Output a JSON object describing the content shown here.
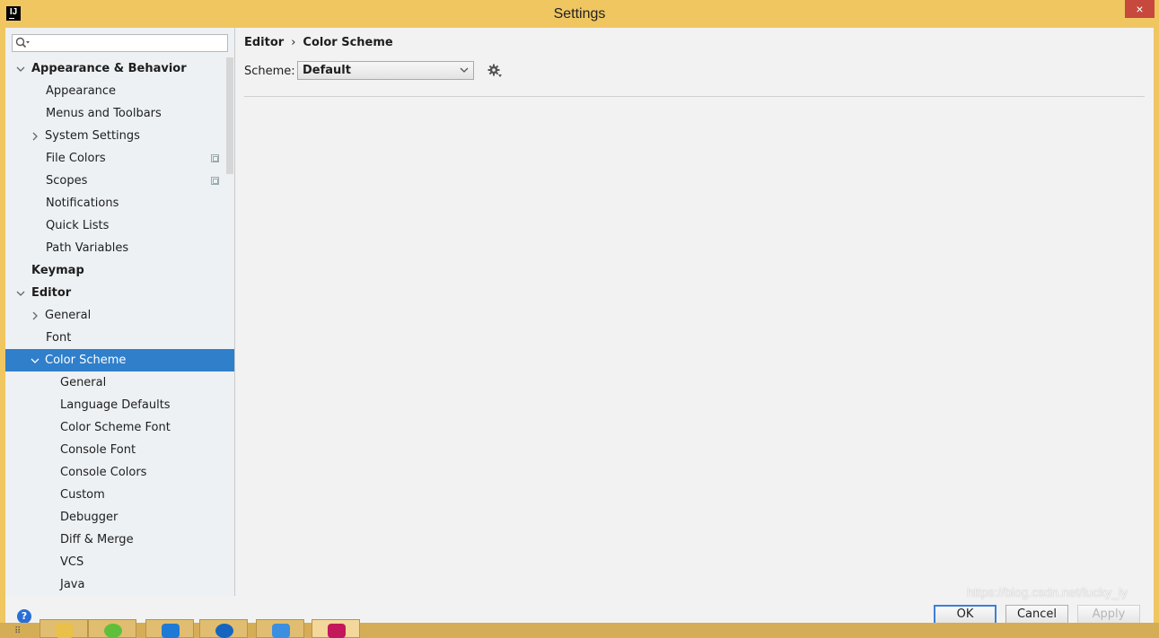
{
  "window": {
    "title": "Settings",
    "app_icon_text": "IJ",
    "close_glyph": "×"
  },
  "search": {
    "placeholder": "",
    "value": ""
  },
  "tree": [
    {
      "label": "Appearance & Behavior",
      "level": 0,
      "expander": "down",
      "bold": true
    },
    {
      "label": "Appearance",
      "level": 1
    },
    {
      "label": "Menus and Toolbars",
      "level": 1
    },
    {
      "label": "System Settings",
      "level": 1,
      "expander": "right"
    },
    {
      "label": "File Colors",
      "level": 1,
      "copy_icon": true
    },
    {
      "label": "Scopes",
      "level": 1,
      "copy_icon": true
    },
    {
      "label": "Notifications",
      "level": 1
    },
    {
      "label": "Quick Lists",
      "level": 1
    },
    {
      "label": "Path Variables",
      "level": 1
    },
    {
      "label": "Keymap",
      "level": 0,
      "bold": true
    },
    {
      "label": "Editor",
      "level": 0,
      "expander": "down",
      "bold": true
    },
    {
      "label": "General",
      "level": 1,
      "expander": "right"
    },
    {
      "label": "Font",
      "level": 1
    },
    {
      "label": "Color Scheme",
      "level": 1,
      "expander": "down",
      "selected": true
    },
    {
      "label": "General",
      "level": 2
    },
    {
      "label": "Language Defaults",
      "level": 2
    },
    {
      "label": "Color Scheme Font",
      "level": 2
    },
    {
      "label": "Console Font",
      "level": 2
    },
    {
      "label": "Console Colors",
      "level": 2
    },
    {
      "label": "Custom",
      "level": 2
    },
    {
      "label": "Debugger",
      "level": 2
    },
    {
      "label": "Diff & Merge",
      "level": 2
    },
    {
      "label": "VCS",
      "level": 2
    },
    {
      "label": "Java",
      "level": 2
    }
  ],
  "breadcrumb": {
    "parent": "Editor",
    "separator": "›",
    "current": "Color Scheme"
  },
  "scheme": {
    "label": "Scheme:",
    "selected": "Default"
  },
  "footer": {
    "help_glyph": "?",
    "ok_label": "OK",
    "cancel_label": "Cancel",
    "apply_label": "Apply"
  },
  "watermark": "https://blog.csdn.net/lucky_ly",
  "colors": {
    "title_bar": "#f0c661",
    "selection": "#2f7fcb",
    "close": "#c7483d",
    "ok_border": "#3c7fd9"
  }
}
